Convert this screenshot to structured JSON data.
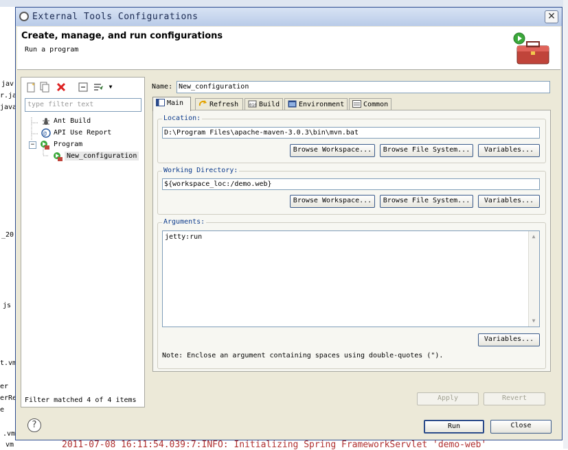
{
  "background": {
    "left_fragments": [
      "jav",
      "r.ja",
      "java",
      "_20",
      "js",
      "t.vm",
      "er",
      "erRe",
      "e",
      ".vm",
      "vm"
    ],
    "bottom_log": "2011-07-08 16:11:54.039:7:INFO:  Initializing Spring FrameworkServlet 'demo-web'"
  },
  "dialog": {
    "title": "External Tools Configurations",
    "close_symbol": "✕",
    "header_title": "Create, manage, and run configurations",
    "header_subtitle": "Run a program"
  },
  "left_panel": {
    "filter_placeholder": "type filter text",
    "tree": [
      {
        "label": "Ant Build",
        "icon": "ant-icon"
      },
      {
        "label": "API Use Report",
        "icon": "api-report-icon"
      },
      {
        "label": "Program",
        "icon": "program-icon",
        "expanded": true
      },
      {
        "label": "New_configuration",
        "icon": "program-config-icon",
        "selected": true
      }
    ],
    "filter_status": "Filter matched 4 of 4 items",
    "expander": "−"
  },
  "main": {
    "name_label": "Name:",
    "name_value": "New_configuration",
    "tabs": [
      {
        "label": "Main",
        "active": true
      },
      {
        "label": "Refresh"
      },
      {
        "label": "Build"
      },
      {
        "label": "Environment"
      },
      {
        "label": "Common"
      }
    ],
    "location": {
      "label": "Location:",
      "value": "D:\\Program Files\\apache-maven-3.0.3\\bin\\mvn.bat",
      "browse_workspace": "Browse Workspace...",
      "browse_fs": "Browse File System...",
      "variables": "Variables..."
    },
    "working_dir": {
      "label": "Working Directory:",
      "value": "${workspace_loc:/demo.web}",
      "browse_workspace": "Browse Workspace...",
      "browse_fs": "Browse File System...",
      "variables": "Variables..."
    },
    "arguments": {
      "label": "Arguments:",
      "value": "jetty:run",
      "variables": "Variables...",
      "note": "Note: Enclose an argument containing spaces using double-quotes (\")."
    },
    "apply": "Apply",
    "revert": "Revert"
  },
  "footer": {
    "help_symbol": "?",
    "run": "Run",
    "close": "Close"
  }
}
